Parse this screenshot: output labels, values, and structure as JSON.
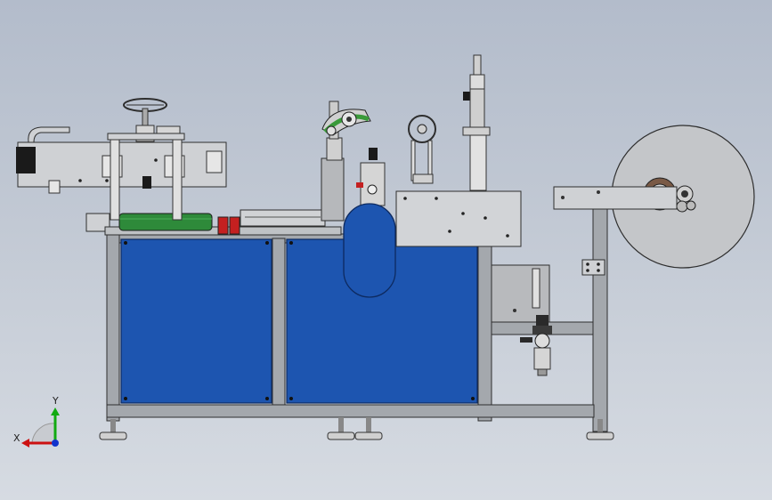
{
  "viewport": {
    "background_top": "#b3bccb",
    "background_bottom": "#d6dbe2"
  },
  "colors": {
    "frame": "#a4a8ad",
    "frame_edge": "#2e2e2e",
    "panel_blue": "#1d55b0",
    "panel_blue_edge": "#0d2a60",
    "plate": "#cfd1d4",
    "roller_green": "#2e8a3a",
    "roller_red": "#c42020",
    "sensor_green": "#3a9a3a",
    "dark_part": "#2a2a2a"
  },
  "triad": {
    "x_label": "X",
    "y_label": "Y",
    "x_color": "#cc1111",
    "y_color": "#11aa11",
    "z_color": "#1133cc"
  },
  "components": [
    {
      "id": "label-roll",
      "icon": "label-roll-icon"
    },
    {
      "id": "unwind-arm",
      "icon": "arm-icon"
    },
    {
      "id": "handwheel-left",
      "icon": "handwheel-icon"
    },
    {
      "id": "handwheel-right",
      "icon": "handwheel-icon"
    },
    {
      "id": "left-conveyor-head",
      "icon": "conveyor-icon"
    },
    {
      "id": "green-roller",
      "icon": "roller-icon"
    },
    {
      "id": "blue-cabinet-doors",
      "icon": "door-icon"
    },
    {
      "id": "blue-oval-guard",
      "icon": "guard-icon"
    },
    {
      "id": "vertical-post",
      "icon": "post-icon"
    },
    {
      "id": "air-filter-regulator",
      "icon": "filter-regulator-icon"
    },
    {
      "id": "leveling-feet",
      "icon": "foot-icon"
    }
  ]
}
